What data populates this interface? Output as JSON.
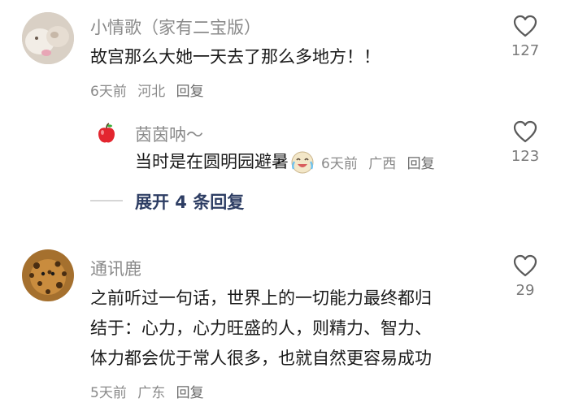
{
  "comments": [
    {
      "username": "小情歌（家有二宝版）",
      "text_lines": [
        "故宫那么大她一天去了那么多地方！！"
      ],
      "time": "6天前",
      "location": "河北",
      "reply_label": "回复",
      "likes": "127",
      "avatar_icon": "cat-avatar-icon"
    },
    {
      "username": "通讯鹿",
      "text_lines": [
        "之前听过一句话，世界上的一切能力最终都归",
        "结于：心力，心力旺盛的人，则精力、智力、",
        "体力都会优于常人很多，也就自然更容易成功"
      ],
      "time": "5天前",
      "location": "广东",
      "reply_label": "回复",
      "likes": "29",
      "avatar_icon": "leopard-avatar-icon"
    }
  ],
  "reply": {
    "username": "茵茵呐～",
    "text": "当时是在圆明园避暑",
    "emoji": "crying-laughing-emoji",
    "time": "6天前",
    "location": "广西",
    "reply_label": "回复",
    "likes": "123",
    "avatar_icon": "apple-avatar-icon"
  },
  "expand_replies": {
    "label": "展开 4 条回复"
  },
  "colors": {
    "username": "#8a8a8a",
    "expand_text": "#2d3d63",
    "heart_stroke": "#5a5a5a"
  }
}
